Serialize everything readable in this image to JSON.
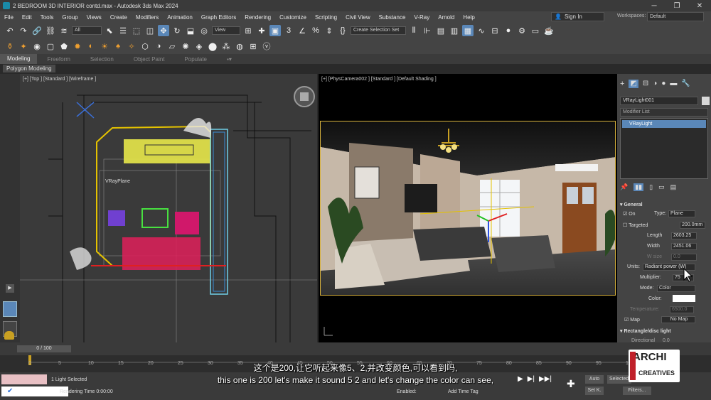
{
  "window": {
    "title": "2 BEDROOM 3D  INTERIOR contd.max - Autodesk 3ds Max 2024"
  },
  "menu": [
    "File",
    "Edit",
    "Tools",
    "Group",
    "Views",
    "Create",
    "Modifiers",
    "Animation",
    "Graph Editors",
    "Rendering",
    "Customize",
    "Scripting",
    "Civil View",
    "Substance",
    "V-Ray",
    "Arnold",
    "Help"
  ],
  "account": {
    "signin": "Sign In",
    "workspaces_label": "Workspaces:",
    "workspace": "Default"
  },
  "toolbar": {
    "filter": "All",
    "view": "View",
    "selection_set": "Create Selection Set"
  },
  "ribbon": {
    "tabs": [
      "Modeling",
      "Freeform",
      "Selection",
      "Object Paint",
      "Populate"
    ],
    "active": "Modeling",
    "sub": "Polygon Modeling"
  },
  "viewport_left": {
    "label": "[+] [Top ] [Standard ] [Wireframe ]",
    "object_label": "VRayPlane"
  },
  "viewport_right": {
    "label": "[+] [PhysCamera002 ] [Standard ] [Default Shading ]"
  },
  "command_panel": {
    "object_name": "VRayLight001",
    "modifier_list": "Modifier List",
    "stack_item": "VRayLight",
    "general": "General",
    "on": "On",
    "type_label": "Type:",
    "type": "Plane",
    "targeted": "Targeted",
    "targeted_value": "200.0mm",
    "length_label": "Length",
    "length": "2603.25",
    "width_label": "Width",
    "width": "2451.06",
    "wsize_label": "W size",
    "wsize": "0.0",
    "units_label": "Units:",
    "units": "Radiant power (W)",
    "multiplier_label": "Multiplier:",
    "multiplier": "75",
    "mode_label": "Mode:",
    "mode": "Color",
    "color_label": "Color:",
    "temperature_label": "Temperature:",
    "temperature": "6500.0",
    "map_label": "Map",
    "nomap": "No Map",
    "rect_section": "Rectangle/disc light",
    "directional_label": "Directional",
    "directional": "0.0"
  },
  "timeline": {
    "frame": "0 / 100",
    "ticks": [
      "0",
      "5",
      "10",
      "15",
      "20",
      "25",
      "30",
      "35",
      "40",
      "45",
      "50",
      "55",
      "60",
      "65",
      "70",
      "75",
      "80",
      "85",
      "90",
      "95",
      "100"
    ]
  },
  "status": {
    "selected": "1 Light Selected",
    "time": "Rendering Time  0:00:00",
    "enabled": "Enabled:",
    "add_time_tag": "Add Time Tag",
    "auto": "Auto",
    "selected_btn": "Selected",
    "setk": "Set K.",
    "filters": "Filters..."
  },
  "subtitles": {
    "zh": "这个是200,让它听起来像5、2,并改变颜色,可以看到吗,",
    "en": "this one is 200 let's make it sound 5 2 and let's change the color can see,"
  },
  "brand": {
    "line1": "ARCHI",
    "line2": "CREATIVES"
  }
}
